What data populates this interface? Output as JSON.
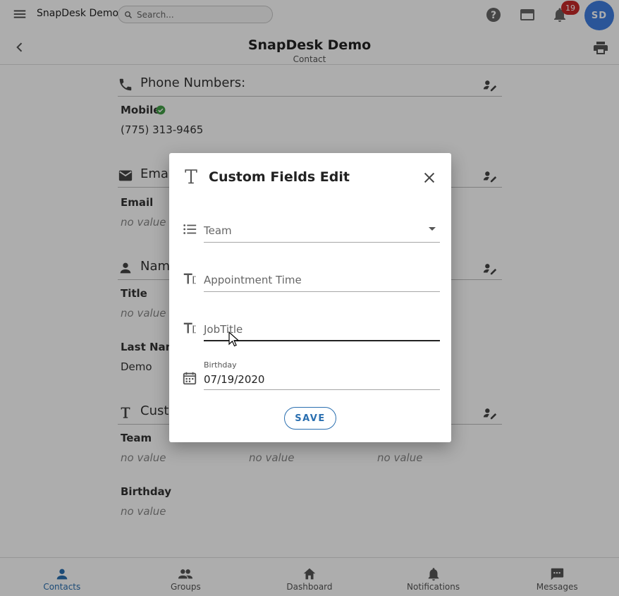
{
  "topbar": {
    "app_name": "SnapDesk Demo",
    "search_placeholder": "Search...",
    "notification_count": "19",
    "avatar_initials": "SD"
  },
  "header": {
    "title": "SnapDesk Demo",
    "subtitle": "Contact"
  },
  "sections": {
    "phone": {
      "title": "Phone Numbers:",
      "label": "Mobile",
      "value": "(775) 313-9465"
    },
    "email": {
      "title": "Ema",
      "label": "Email",
      "value": "no value"
    },
    "name": {
      "title": "Nam",
      "title_label": "Title",
      "title_value": "no value",
      "last_label": "Last Nam",
      "last_value": "Demo"
    },
    "custom": {
      "title": "Cust",
      "team_label": "Team",
      "team_value": "no value",
      "col2_value": "no value",
      "col3_value": "no value",
      "birthday_label": "Birthday",
      "birthday_value": "no value"
    }
  },
  "bottom_nav": [
    {
      "label": "Contacts",
      "icon": "person-icon",
      "active": true
    },
    {
      "label": "Groups",
      "icon": "groups-icon",
      "active": false
    },
    {
      "label": "Dashboard",
      "icon": "home-icon",
      "active": false
    },
    {
      "label": "Notifications",
      "icon": "bell-icon",
      "active": false
    },
    {
      "label": "Messages",
      "icon": "chat-icon",
      "active": false
    }
  ],
  "dialog": {
    "title": "Custom Fields Edit",
    "fields": {
      "team": {
        "label": "Team"
      },
      "appointment": {
        "label": "Appointment Time"
      },
      "jobtitle": {
        "label": "JobTitle"
      },
      "birthday": {
        "label": "Birthday",
        "value": "07/19/2020"
      }
    },
    "save_label": "SAVE"
  },
  "colors": {
    "accent": "#2a6fb0",
    "avatar": "#3f7ee0",
    "badge": "#c62828",
    "verified": "#43a047"
  }
}
